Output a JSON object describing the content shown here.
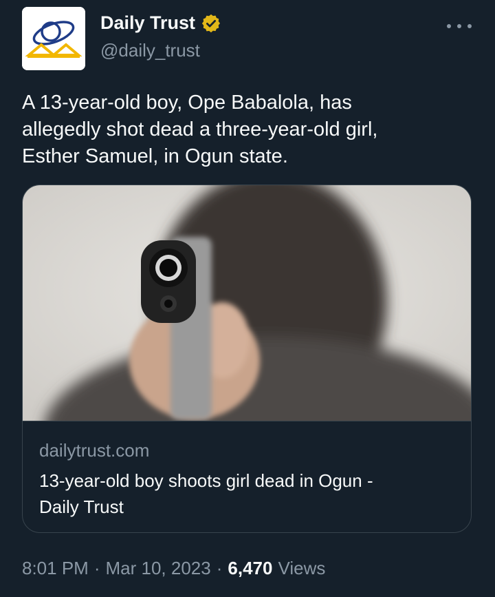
{
  "account": {
    "display_name": "Daily Trust",
    "handle": "@daily_trust",
    "verified_icon": "verified-badge-icon",
    "avatar_icon": "daily-trust-logo"
  },
  "more_icon": "more-options-icon",
  "tweet": {
    "text": "A 13-year-old boy, Ope Babalola, has\nallegedly shot dead a three-year-old girl,\nEsther Samuel, in Ogun state."
  },
  "card": {
    "image_description_icon": "card-image",
    "domain": "dailytrust.com",
    "title": "13-year-old boy shoots girl dead in Ogun -\nDaily Trust"
  },
  "meta": {
    "time": "8:01 PM",
    "separator": "·",
    "date": "Mar 10, 2023",
    "views_count": "6,470",
    "views_label": "Views"
  },
  "colors": {
    "background": "#15202b",
    "text_primary": "#f7f9f9",
    "text_secondary": "#8b98a5",
    "border": "#38444d",
    "verified_gold": "#e2b719"
  }
}
